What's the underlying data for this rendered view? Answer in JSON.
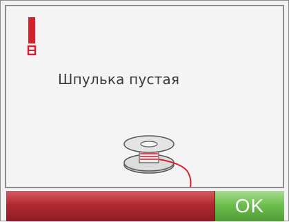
{
  "dialog": {
    "message": "Шпулька пустая",
    "warning_icon": "exclamation-warning-icon",
    "bobbin_icon": "empty-bobbin-icon",
    "colors": {
      "warning": "#d3212f",
      "bar_red": "#b22a33",
      "ok_green": "#6fbf4f",
      "thread": "#d3212f"
    }
  },
  "buttons": {
    "ok_label": "OK"
  }
}
